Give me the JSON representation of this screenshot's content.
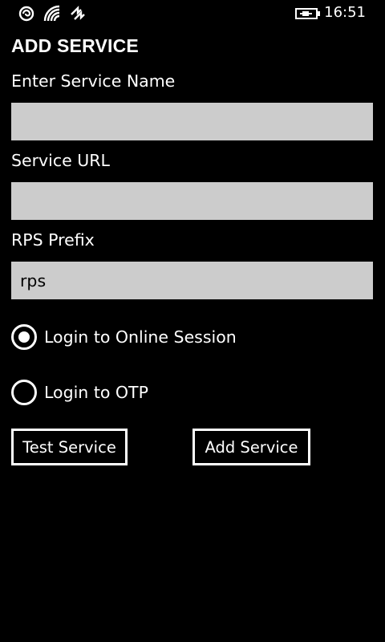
{
  "status_bar": {
    "icons": [
      "notification-icon",
      "wifi-icon",
      "data-sync-icon",
      "battery-charging-icon"
    ],
    "time": "16:51"
  },
  "page": {
    "title": "ADD SERVICE"
  },
  "form": {
    "service_name": {
      "label": "Enter Service Name",
      "value": ""
    },
    "service_url": {
      "label": "Service URL",
      "value": ""
    },
    "rps_prefix": {
      "label": "RPS Prefix",
      "value": "rps"
    }
  },
  "login_options": [
    {
      "label": "Login to Online Session",
      "selected": true
    },
    {
      "label": "Login to OTP",
      "selected": false
    }
  ],
  "buttons": {
    "test_service": "Test Service",
    "add_service": "Add Service"
  },
  "colors": {
    "background": "#000000",
    "foreground": "#ffffff",
    "input_background": "#cccccc"
  }
}
